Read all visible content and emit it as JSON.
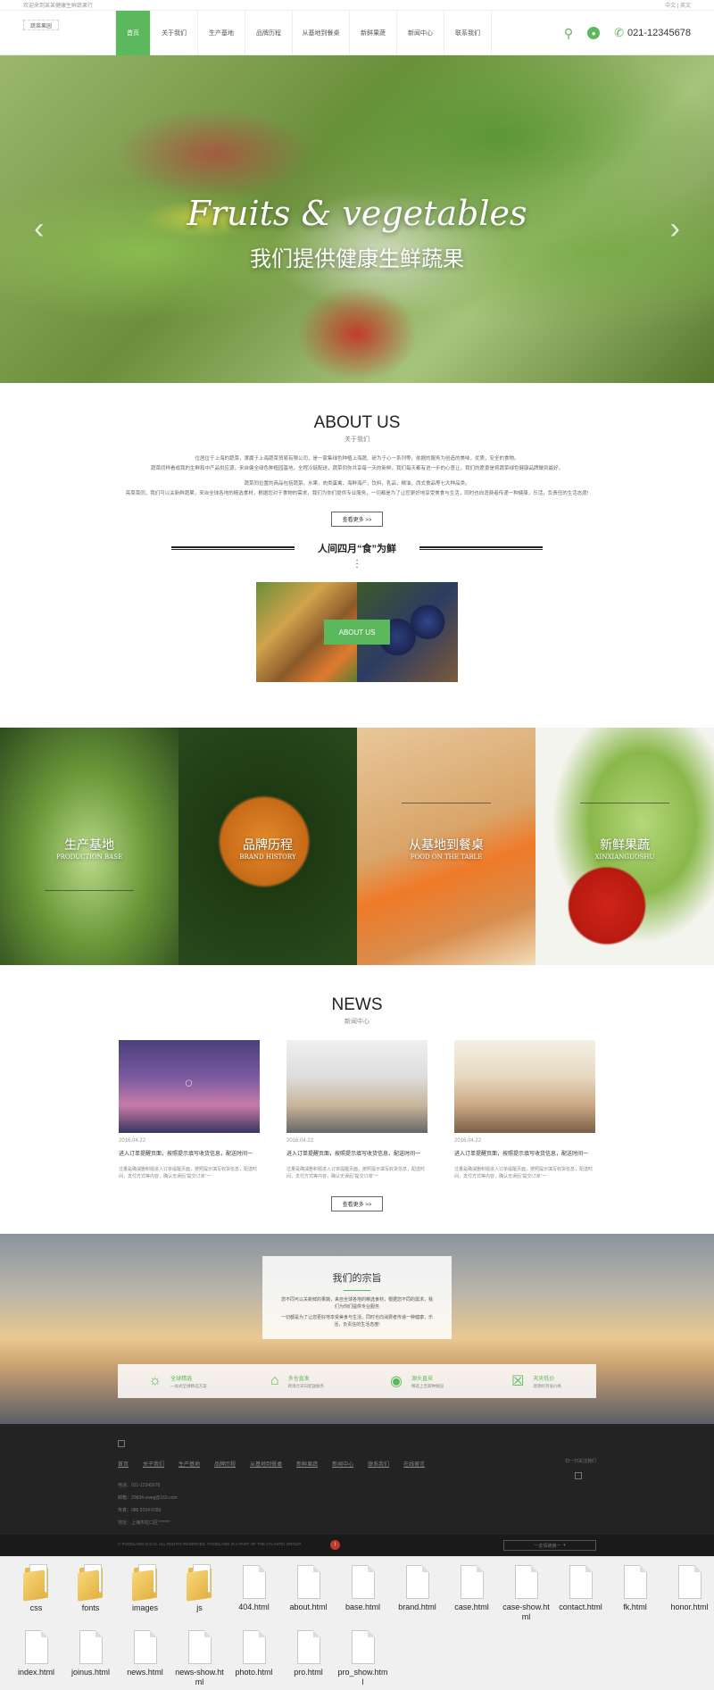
{
  "topbar": {
    "left": "欢迎来到某某健康生鲜蔬果行",
    "right": "中文 | 英文"
  },
  "header": {
    "logo_alt": "蔬菜果园",
    "menu": [
      "首页",
      "关于我们",
      "生产基地",
      "品牌历程",
      "从基地到餐桌",
      "新鲜果蔬",
      "新闻中心",
      "联系我们"
    ],
    "phone": "021-12345678"
  },
  "hero": {
    "title": "Fruits & vegetables",
    "subtitle": "我们提供健康生鲜蔬果"
  },
  "about": {
    "title": "ABOUT US",
    "subtitle": "关于我们",
    "paragraphs": [
      "位居位于上海的蔬菜，隶属于上海蔬菜贸易有限公司，是一家集绿色种植上海蔬、研为于心一系列等，依据的服务为创造的美味，优质，安全的食物。",
      "蔬菜同样看成我的生鲜和中产品供应源，来自健全绿色种植园基地，全程冷链配送，蔬菜同你共享每一天的新鲜，我们每天都有进一步的心意让，我们的愿景是将蔬菜绿色健康品牌做到最好。",
      "蔬菜同位置的商品包括蔬菜，水果，肉类蛋禽，海鲜海产，饮料，乳品，粮油，西式食品等七大种品类。",
      "亮菜菜同，我们可以关新鲜蔬果，来自全球各地的精选食材，根据您对于食物的需求，我们为你们提供专业服务，一切都是为了让您更好地享受美食与生活，同时也向消费者传递一种健康，乐活，负责任的生活态度!"
    ],
    "more_label": "查看更多 >>",
    "slogan": "人间四月“食”为鲜",
    "badge": "ABOUT US"
  },
  "tiles": [
    {
      "cn": "生产基地",
      "en": "PRODUCTION BASE"
    },
    {
      "cn": "品牌历程",
      "en": "BRAND HISTORY"
    },
    {
      "cn": "从基地到餐桌",
      "en": "FOOD ON THE TABLE"
    },
    {
      "cn": "新鲜果蔬",
      "en": "XINXIANGUOSHU"
    }
  ],
  "news": {
    "title": "NEWS",
    "subtitle": "新闻中心",
    "more_label": "查看更多 >>",
    "items": [
      {
        "date": "2016.04.22",
        "title": "进入订单提醒页面，按照提示填写收货信息，配送时间一",
        "desc": "过量是确减删积题进入订单提醒页面，按照提示填写收货信息，配送时间，支付方式等内容，确认无误后“提交订单”一"
      },
      {
        "date": "2016.04.22",
        "title": "进入订单提醒页面，按照提示填写收货信息，配送时间一",
        "desc": "过量是确减删积题进入订单提醒页面，按照提示填写收货信息，配送时间，支付方式等内容，确认无误后“提交订单”一"
      },
      {
        "date": "2016.04.22",
        "title": "进入订单提醒页面，按照提示填写收货信息，配送时间一",
        "desc": "过量是确减删积题进入订单提醒页面，按照提示填写收货信息，配送时间，支付方式等内容，确认无误后“提交订单”一"
      }
    ]
  },
  "mission": {
    "title": "我们的宗旨",
    "text1": "您不同可以关新鲜的果蔬，来自全球各地的精选食材，根据您不同的需求，我们为你们提供专业服务",
    "text2": "一切都是为了让您更好地享受美食与生活，同时也向消费者传递一种健康，乐活，负责任的生活态度!",
    "features": [
      {
        "title": "全球精选",
        "desc": "一站式全球精选方案"
      },
      {
        "title": "多仓直发",
        "desc": "跨境仓日日配送服务"
      },
      {
        "title": "源头直采",
        "desc": "精选上百家种植园"
      },
      {
        "title": "天天低价",
        "desc": "源源好货低价格"
      }
    ]
  },
  "footer": {
    "links": [
      "首页",
      "关于我们",
      "生产基地",
      "品牌历程",
      "从基地到餐桌",
      "新鲜果蔬",
      "新闻中心",
      "联系我们",
      "在线留言"
    ],
    "contact": [
      "电话：021-12345678",
      "邮箱：20834-sweg@163.com",
      "传真：086 5234 6789",
      "地址：上海市虹口区*******"
    ],
    "qr_label": "扫一扫关注我们",
    "copyright": "© FOODLAND D.O.O. ALL RIGHTS RESERVED. FOODLAND IS A PART OF THE ATLANTIC GROUP.",
    "friend_links": "一友情链接一"
  },
  "file_explorer": {
    "items": [
      {
        "name": "css",
        "type": "folder"
      },
      {
        "name": "fonts",
        "type": "folder"
      },
      {
        "name": "images",
        "type": "folder"
      },
      {
        "name": "js",
        "type": "folder"
      },
      {
        "name": "404.html",
        "type": "file"
      },
      {
        "name": "about.html",
        "type": "file"
      },
      {
        "name": "base.html",
        "type": "file"
      },
      {
        "name": "brand.html",
        "type": "file"
      },
      {
        "name": "case.html",
        "type": "file"
      },
      {
        "name": "case-show.html",
        "type": "file"
      },
      {
        "name": "contact.html",
        "type": "file"
      },
      {
        "name": "fk.html",
        "type": "file"
      },
      {
        "name": "honor.html",
        "type": "file"
      },
      {
        "name": "index.html",
        "type": "file"
      },
      {
        "name": "joinus.html",
        "type": "file"
      },
      {
        "name": "news.html",
        "type": "file"
      },
      {
        "name": "news-show.html",
        "type": "file"
      },
      {
        "name": "photo.html",
        "type": "file"
      },
      {
        "name": "pro.html",
        "type": "file"
      },
      {
        "name": "pro_show.html",
        "type": "file"
      }
    ]
  },
  "colors": {
    "accent": "#5cb85c",
    "footer_bg": "#232323"
  }
}
